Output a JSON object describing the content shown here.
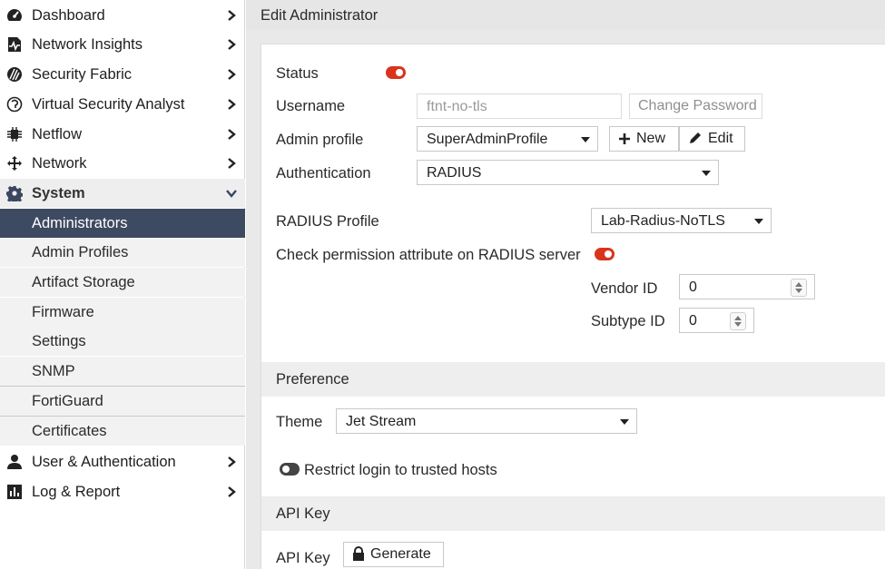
{
  "sidebar": {
    "items": [
      {
        "label": "Dashboard",
        "icon": "dashboard-icon"
      },
      {
        "label": "Network Insights",
        "icon": "network-insights-icon"
      },
      {
        "label": "Security Fabric",
        "icon": "security-fabric-icon"
      },
      {
        "label": "Virtual Security Analyst",
        "icon": "virtual-security-analyst-icon"
      },
      {
        "label": "Netflow",
        "icon": "netflow-icon"
      },
      {
        "label": "Network",
        "icon": "network-icon"
      },
      {
        "label": "System",
        "icon": "gear-icon"
      }
    ],
    "system_children": [
      {
        "label": "Administrators"
      },
      {
        "label": "Admin Profiles"
      },
      {
        "label": "Artifact Storage"
      },
      {
        "label": "Firmware"
      },
      {
        "label": "Settings"
      },
      {
        "label": "SNMP"
      },
      {
        "label": "FortiGuard"
      },
      {
        "label": "Certificates"
      }
    ],
    "bottom_items": [
      {
        "label": "User & Authentication",
        "icon": "user-icon"
      },
      {
        "label": "Log & Report",
        "icon": "log-report-icon"
      }
    ]
  },
  "header": {
    "title": "Edit Administrator"
  },
  "form": {
    "status_label": "Status",
    "username_label": "Username",
    "username_value": "ftnt-no-tls",
    "change_password_label": "Change Password",
    "admin_profile_label": "Admin profile",
    "admin_profile_value": "SuperAdminProfile",
    "new_label": "New",
    "edit_label": "Edit",
    "authentication_label": "Authentication",
    "authentication_value": "RADIUS",
    "radius_profile_label": "RADIUS Profile",
    "radius_profile_value": "Lab-Radius-NoTLS",
    "check_permission_label": "Check permission attribute on RADIUS server",
    "vendor_id_label": "Vendor ID",
    "vendor_id_value": "0",
    "subtype_id_label": "Subtype ID",
    "subtype_id_value": "0"
  },
  "preference": {
    "section_title": "Preference",
    "theme_label": "Theme",
    "theme_value": "Jet Stream",
    "restrict_label": "Restrict login to trusted hosts"
  },
  "api_key": {
    "section_title": "API Key",
    "api_key_label": "API Key",
    "generate_label": "Generate"
  },
  "colors": {
    "accent": "#d8341b",
    "active_nav": "#3e4a61"
  }
}
